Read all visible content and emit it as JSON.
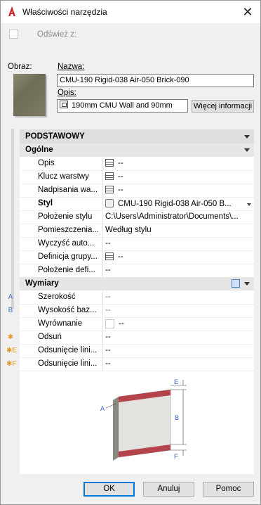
{
  "window": {
    "title": "Właściwości narzędzia"
  },
  "refresh": {
    "label": "Odśwież z:"
  },
  "image": {
    "label": "Obraz:"
  },
  "name": {
    "label": "Nazwa:",
    "value": "CMU-190 Rigid-038 Air-050 Brick-090"
  },
  "description": {
    "label": "Opis:",
    "value": "190mm CMU Wall and 90mm",
    "more_label": "Więcej informacji"
  },
  "categories": {
    "basic": "PODSTAWOWY",
    "general": "Ogólne",
    "dimensions": "Wymiary"
  },
  "general_rows": [
    {
      "key": "Opis",
      "value": "--",
      "icon": "list-icon"
    },
    {
      "key": "Klucz warstwy",
      "value": "--",
      "icon": "list-icon"
    },
    {
      "key": "Nadpisania wa...",
      "value": "--",
      "icon": "list-icon"
    },
    {
      "key": "Styl",
      "value": "CMU-190 Rigid-038 Air-050 B...",
      "icon": "style-icon"
    },
    {
      "key": "Położenie stylu",
      "value": "C:\\Users\\Administrator\\Documents\\..."
    },
    {
      "key": "Pomieszczenia...",
      "value": "Według stylu"
    },
    {
      "key": "Wyczyść auto...",
      "value": "--"
    },
    {
      "key": "Definicja grupy...",
      "value": "--",
      "icon": "group-icon"
    },
    {
      "key": "Położenie defi...",
      "value": "--"
    }
  ],
  "dimension_rows": [
    {
      "marker": "A",
      "key": "Szerokość",
      "value": "--"
    },
    {
      "marker": "B",
      "key": "Wysokość baz...",
      "value": "--"
    },
    {
      "marker": "",
      "key": "Wyrównanie",
      "value": "--"
    },
    {
      "marker": "✱",
      "key": "Odsuń",
      "value": "--"
    },
    {
      "marker": "✱E",
      "key": "Odsunięcie lini...",
      "value": "--"
    },
    {
      "marker": "✱F",
      "key": "Odsunięcie lini...",
      "value": "--"
    }
  ],
  "figure_labels": {
    "a": "A",
    "b": "B",
    "e": "E",
    "f": "F"
  },
  "buttons": {
    "ok": "OK",
    "cancel": "Anuluj",
    "help": "Pomoc"
  }
}
